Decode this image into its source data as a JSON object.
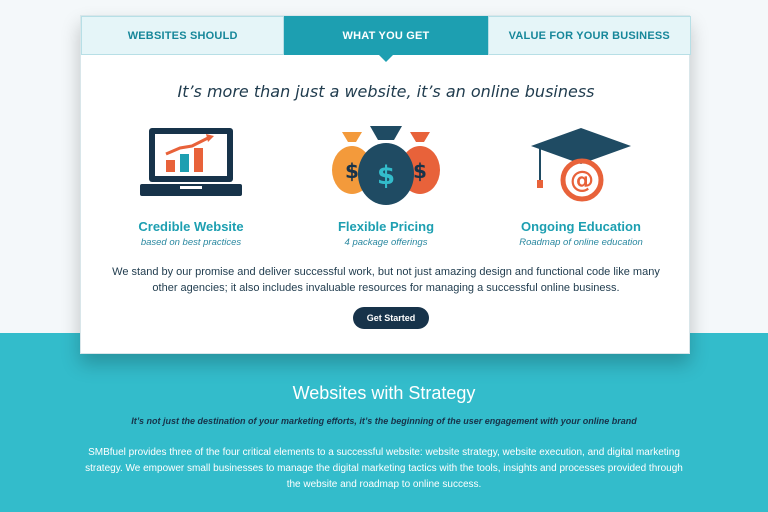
{
  "tabs": [
    {
      "label": "WEBSITES SHOULD"
    },
    {
      "label": "WHAT YOU GET"
    },
    {
      "label": "VALUE FOR YOUR BUSINESS"
    }
  ],
  "card": {
    "headline": "It’s more than just a website, it’s an online business",
    "features": [
      {
        "icon": "laptop-chart-icon",
        "title": "Credible Website",
        "subtitle": "based on best practices"
      },
      {
        "icon": "money-bags-icon",
        "title": "Flexible Pricing",
        "subtitle": "4 package offerings"
      },
      {
        "icon": "graduation-cap-icon",
        "title": "Ongoing Education",
        "subtitle": "Roadmap of online education"
      }
    ],
    "body": "We stand by our promise and deliver successful work, but not just amazing design and functional code like many other agencies; it also includes invaluable resources for managing a successful online business.",
    "cta_label": "Get Started"
  },
  "strategy": {
    "title": "Websites with Strategy",
    "tagline": "It’s not just the destination of your marketing efforts, it’s the beginning of the user engagement with your online brand",
    "body": "SMBfuel provides three of the four critical elements to a successful website: website strategy, website execution, and digital marketing strategy. We empower small businesses to manage the digital marketing tactics with the tools, insights and processes provided through the website and roadmap to online success."
  },
  "colors": {
    "accent": "#1d9fb1",
    "navy": "#17334a",
    "orange": "#e8623a",
    "teal_band": "#33bccb"
  }
}
